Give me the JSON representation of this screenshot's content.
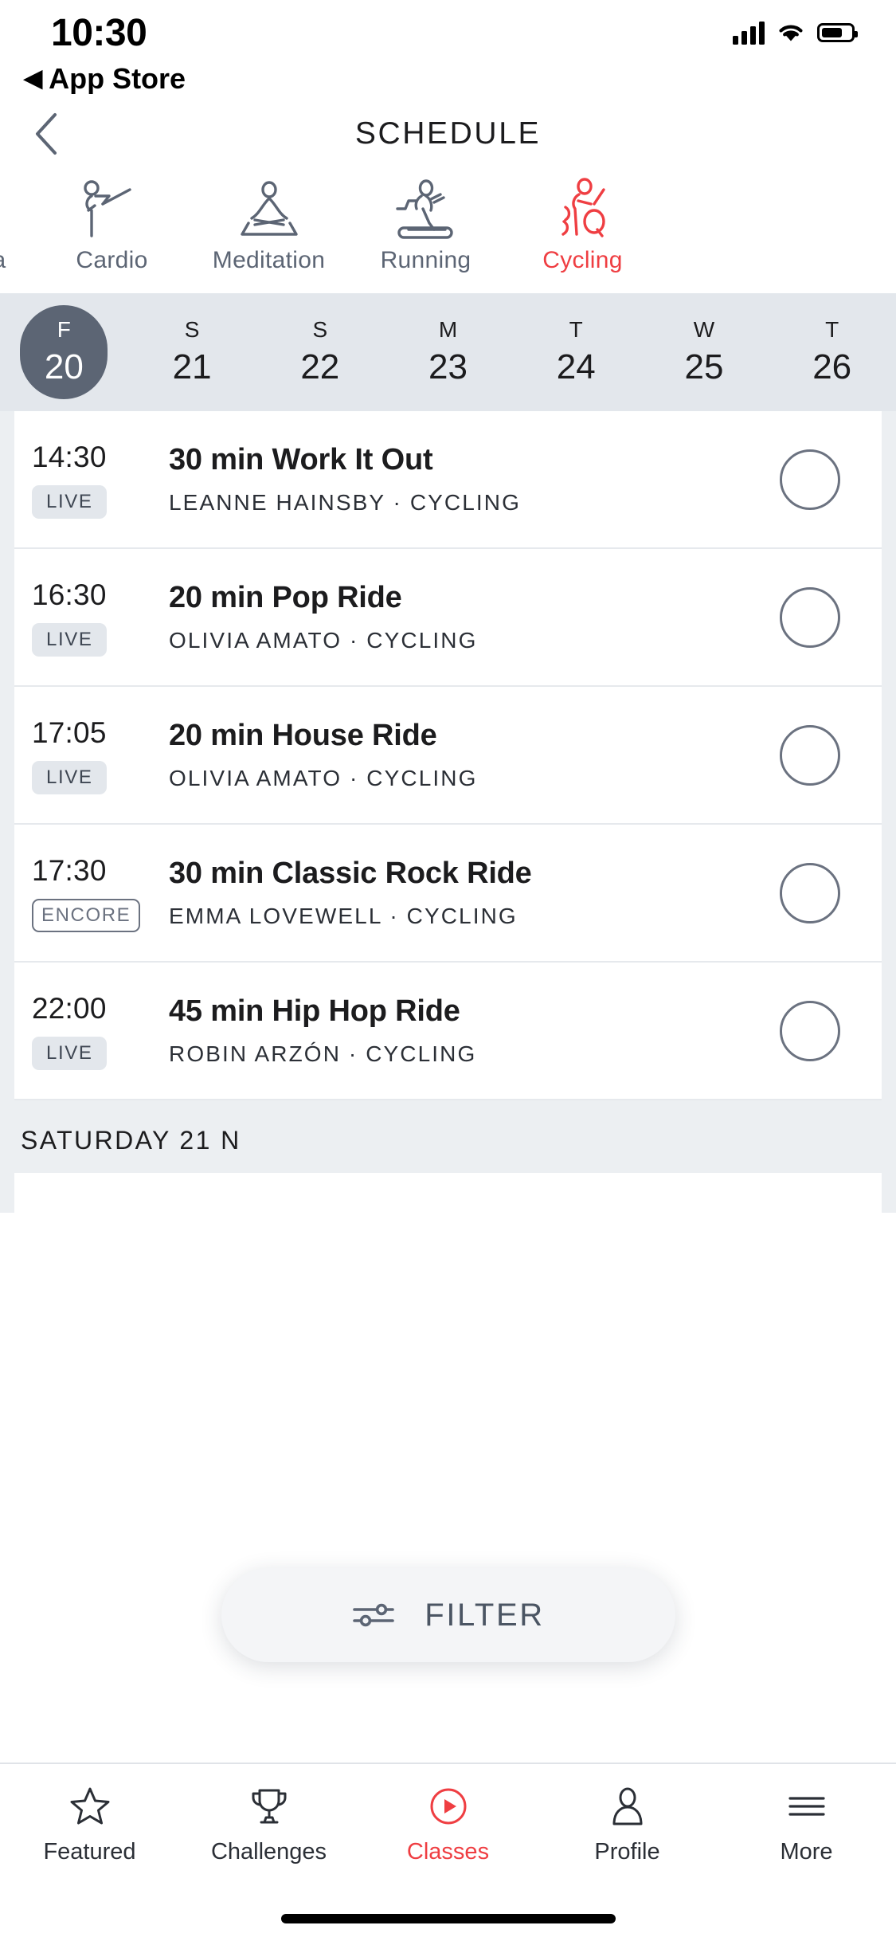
{
  "status_bar": {
    "time": "10:30",
    "back_app_caret": "◀",
    "back_app_label": "App Store",
    "signal_icon": "cellular-signal-icon",
    "wifi_icon": "wifi-icon",
    "battery_icon": "battery-icon"
  },
  "header": {
    "back_icon": "chevron-left-icon",
    "title": "SCHEDULE"
  },
  "categories": {
    "active_color": "#ef3e42",
    "inactive_color": "#5c6574",
    "items": [
      {
        "label": "oga",
        "icon": "yoga-icon",
        "active": false
      },
      {
        "label": "Cardio",
        "icon": "cardio-icon",
        "active": false
      },
      {
        "label": "Meditation",
        "icon": "meditation-icon",
        "active": false
      },
      {
        "label": "Running",
        "icon": "running-treadmill-icon",
        "active": false
      },
      {
        "label": "Cycling",
        "icon": "cycling-icon",
        "active": true
      }
    ]
  },
  "date_strip": {
    "background": "#e3e7ec",
    "selected_pill_color": "#5c6574",
    "days": [
      {
        "dow": "F",
        "num": "20",
        "selected": true
      },
      {
        "dow": "S",
        "num": "21",
        "selected": false
      },
      {
        "dow": "S",
        "num": "22",
        "selected": false
      },
      {
        "dow": "M",
        "num": "23",
        "selected": false
      },
      {
        "dow": "T",
        "num": "24",
        "selected": false
      },
      {
        "dow": "W",
        "num": "25",
        "selected": false
      },
      {
        "dow": "T",
        "num": "26",
        "selected": false
      }
    ]
  },
  "classes": [
    {
      "time": "14:30",
      "badge": "LIVE",
      "badge_style": "live",
      "title": "30 min Work It Out",
      "subtitle": "LEANNE HAINSBY · CYCLING",
      "instructor": "LEANNE HAINSBY",
      "discipline": "CYCLING",
      "select_icon": "empty-circle-icon"
    },
    {
      "time": "16:30",
      "badge": "LIVE",
      "badge_style": "live",
      "title": "20 min Pop Ride",
      "subtitle": "OLIVIA AMATO · CYCLING",
      "instructor": "OLIVIA AMATO",
      "discipline": "CYCLING",
      "select_icon": "empty-circle-icon"
    },
    {
      "time": "17:05",
      "badge": "LIVE",
      "badge_style": "live",
      "title": "20 min House Ride",
      "subtitle": "OLIVIA AMATO · CYCLING",
      "instructor": "OLIVIA AMATO",
      "discipline": "CYCLING",
      "select_icon": "empty-circle-icon"
    },
    {
      "time": "17:30",
      "badge": "ENCORE",
      "badge_style": "encore",
      "title": "30 min Classic Rock Ride",
      "subtitle": "EMMA LOVEWELL · CYCLING",
      "instructor": "EMMA LOVEWELL",
      "discipline": "CYCLING",
      "select_icon": "empty-circle-icon"
    },
    {
      "time": "22:00",
      "badge": "LIVE",
      "badge_style": "live",
      "title": "45 min Hip Hop Ride",
      "subtitle": "ROBIN ARZÓN · CYCLING",
      "instructor": "ROBIN ARZÓN",
      "discipline": "CYCLING",
      "select_icon": "empty-circle-icon"
    }
  ],
  "next_day_header": "SATURDAY 21 N",
  "filter": {
    "label": "FILTER",
    "icon": "sliders-filter-icon"
  },
  "tabbar": {
    "active_color": "#ef3e42",
    "items": [
      {
        "label": "Featured",
        "icon": "star-icon",
        "active": false
      },
      {
        "label": "Challenges",
        "icon": "trophy-icon",
        "active": false
      },
      {
        "label": "Classes",
        "icon": "play-circle-icon",
        "active": true
      },
      {
        "label": "Profile",
        "icon": "person-icon",
        "active": false
      },
      {
        "label": "More",
        "icon": "hamburger-icon",
        "active": false
      }
    ]
  }
}
